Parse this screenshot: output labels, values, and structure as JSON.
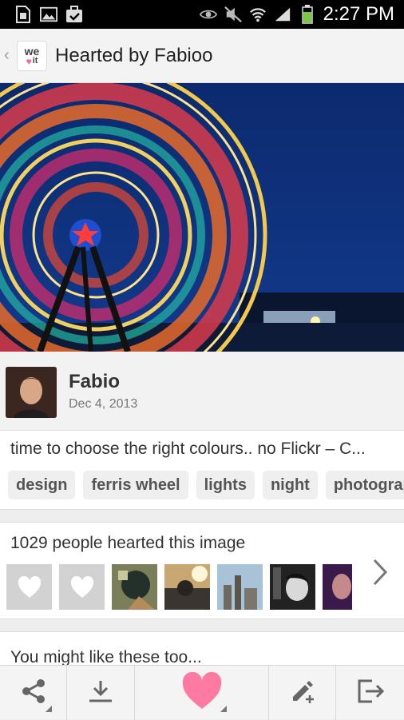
{
  "status_bar": {
    "time": "2:27 PM",
    "icons": [
      "sim-icon",
      "image-icon",
      "clipboard-check-icon",
      "eye-icon",
      "no-sound-icon",
      "wifi-icon",
      "signal-icon",
      "battery-icon"
    ]
  },
  "action_bar": {
    "title": "Hearted by Fabioo",
    "logo_top": "we",
    "logo_bottom": "it"
  },
  "poster": {
    "name": "Fabio",
    "date": "Dec 4, 2013"
  },
  "description": {
    "text": "time to choose the right colours.. no Flickr – C...",
    "tags": [
      "design",
      "ferris wheel",
      "lights",
      "night",
      "photograp"
    ]
  },
  "hearted": {
    "count_text": "1029 people hearted this image"
  },
  "like_section": {
    "title": "You might like these too..."
  },
  "bottom_bar": {
    "buttons": [
      "share-icon",
      "download-icon",
      "heart-icon",
      "edit-add-icon",
      "logout-icon"
    ]
  },
  "colors": {
    "accent": "#ff7aa3",
    "status_bar": "#000000",
    "sky": "#0e2a6e"
  }
}
